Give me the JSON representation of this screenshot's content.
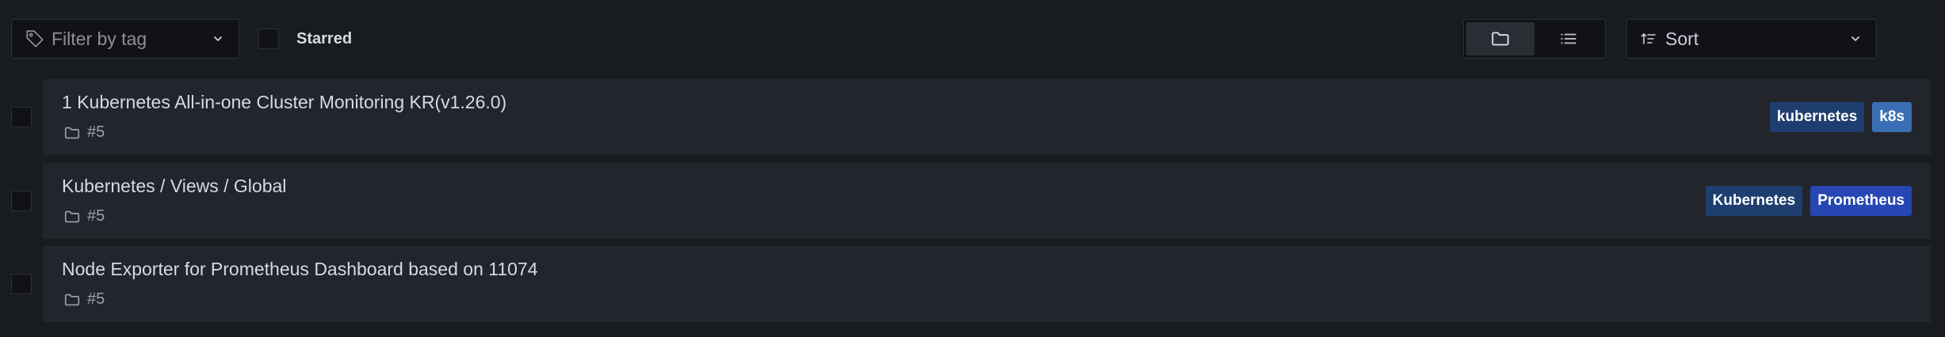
{
  "toolbar": {
    "tag_filter_placeholder": "Filter by tag",
    "starred_label": "Starred",
    "sort_label": "Sort",
    "view_mode": "folder"
  },
  "rows": [
    {
      "title": "1 Kubernetes All-in-one Cluster Monitoring KR(v1.26.0)",
      "folder": "#5",
      "tags": [
        {
          "label": "kubernetes",
          "color": "#1f3e70"
        },
        {
          "label": "k8s",
          "color": "#3a6fb5"
        }
      ]
    },
    {
      "title": "Kubernetes / Views / Global",
      "folder": "#5",
      "tags": [
        {
          "label": "Kubernetes",
          "color": "#1f3e70"
        },
        {
          "label": "Prometheus",
          "color": "#2546b3"
        }
      ]
    },
    {
      "title": "Node Exporter for Prometheus Dashboard based on 11074",
      "folder": "#5",
      "tags": []
    }
  ]
}
